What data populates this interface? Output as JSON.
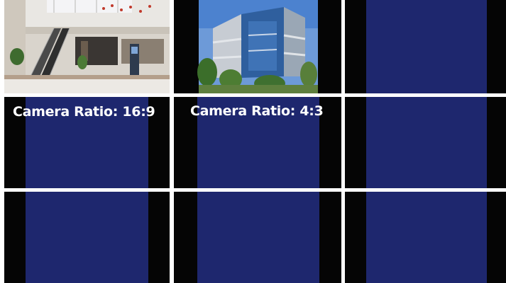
{
  "cameras": [
    {
      "id": 1,
      "ratio_label": "Camera Ratio: 16:9",
      "scene": "mall-interior-escalator"
    },
    {
      "id": 2,
      "ratio_label": "Camera Ratio: 4:3",
      "scene": "glass-office-building"
    },
    {
      "id": 3,
      "ratio_label": "",
      "scene": "no-signal"
    },
    {
      "id": 4,
      "ratio_label": "",
      "scene": "no-signal"
    },
    {
      "id": 5,
      "ratio_label": "",
      "scene": "no-signal"
    },
    {
      "id": 6,
      "ratio_label": "",
      "scene": "no-signal"
    },
    {
      "id": 7,
      "ratio_label": "",
      "scene": "no-signal"
    },
    {
      "id": 8,
      "ratio_label": "",
      "scene": "no-signal"
    },
    {
      "id": 9,
      "ratio_label": "",
      "scene": "no-signal"
    }
  ],
  "colors": {
    "no_signal_blue": "#1e276e",
    "letterbox_black": "#050505",
    "divider_white": "#ffffff"
  }
}
